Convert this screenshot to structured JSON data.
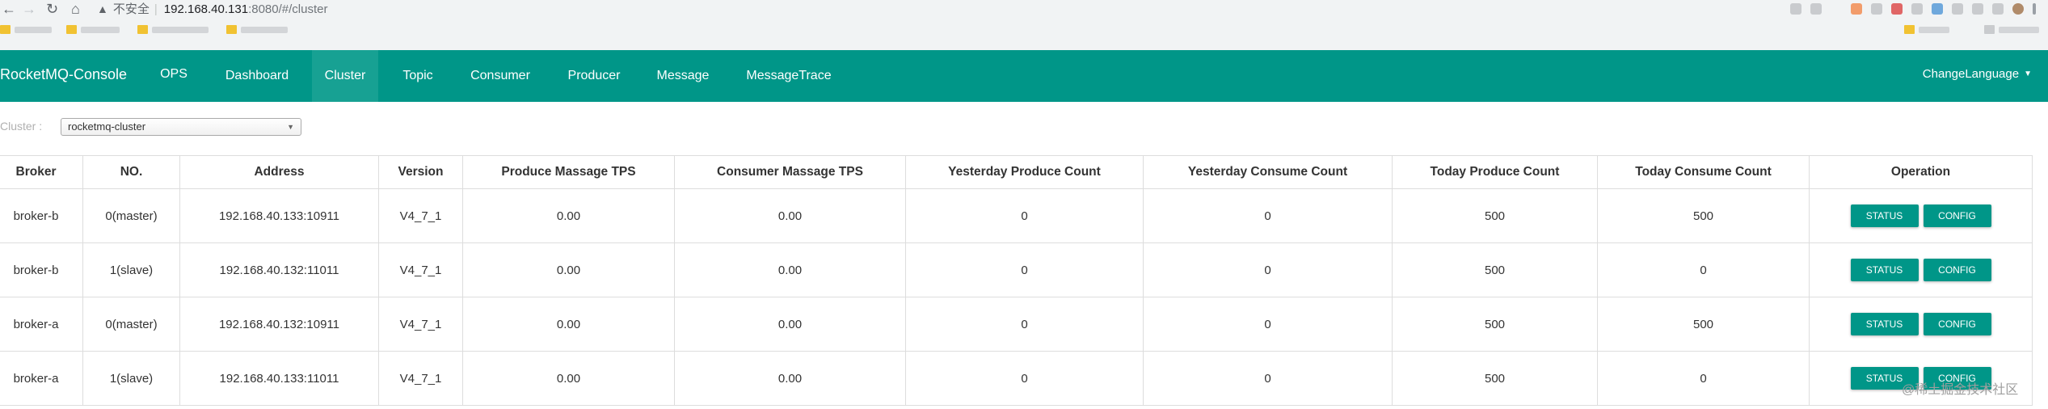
{
  "browser": {
    "address_warning_text": "不安全",
    "url_host": "192.168.40.131",
    "url_rest": ":8080/#/cluster"
  },
  "app": {
    "brand": "RocketMQ-Console",
    "nav": [
      "OPS",
      "Dashboard",
      "Cluster",
      "Topic",
      "Consumer",
      "Producer",
      "Message",
      "MessageTrace"
    ],
    "active_nav": "Cluster",
    "change_language": "ChangeLanguage"
  },
  "cluster_filter": {
    "label": "Cluster :",
    "selected": "rocketmq-cluster"
  },
  "table": {
    "headers": [
      "Broker",
      "NO.",
      "Address",
      "Version",
      "Produce Massage TPS",
      "Consumer Massage TPS",
      "Yesterday Produce Count",
      "Yesterday Consume Count",
      "Today Produce Count",
      "Today Consume Count",
      "Operation"
    ],
    "rows": [
      {
        "broker": "broker-b",
        "no": "0(master)",
        "address": "192.168.40.133:10911",
        "version": "V4_7_1",
        "produce_tps": "0.00",
        "consume_tps": "0.00",
        "yesterday_produce": "0",
        "yesterday_consume": "0",
        "today_produce": "500",
        "today_consume": "500"
      },
      {
        "broker": "broker-b",
        "no": "1(slave)",
        "address": "192.168.40.132:11011",
        "version": "V4_7_1",
        "produce_tps": "0.00",
        "consume_tps": "0.00",
        "yesterday_produce": "0",
        "yesterday_consume": "0",
        "today_produce": "500",
        "today_consume": "0"
      },
      {
        "broker": "broker-a",
        "no": "0(master)",
        "address": "192.168.40.132:10911",
        "version": "V4_7_1",
        "produce_tps": "0.00",
        "consume_tps": "0.00",
        "yesterday_produce": "0",
        "yesterday_consume": "0",
        "today_produce": "500",
        "today_consume": "500"
      },
      {
        "broker": "broker-a",
        "no": "1(slave)",
        "address": "192.168.40.133:11011",
        "version": "V4_7_1",
        "produce_tps": "0.00",
        "consume_tps": "0.00",
        "yesterday_produce": "0",
        "yesterday_consume": "0",
        "today_produce": "500",
        "today_consume": "0"
      }
    ],
    "status_button": "STATUS",
    "config_button": "CONFIG"
  },
  "watermark": "@稀土掘金技术社区",
  "colors": {
    "primary": "#009688",
    "active_tab": "#17a193"
  }
}
